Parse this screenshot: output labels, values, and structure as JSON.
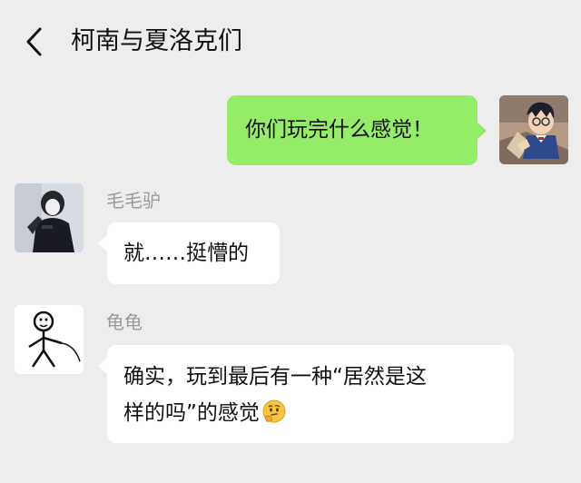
{
  "header": {
    "title": "柯南与夏洛克们"
  },
  "messages": [
    {
      "side": "right",
      "text": "你们玩完什么感觉！",
      "avatar_icon": "conan-avatar-icon"
    },
    {
      "side": "left",
      "sender": "毛毛驴",
      "text": "就……挺懵的",
      "avatar_icon": "dark-figure-avatar-icon"
    },
    {
      "side": "left",
      "sender": "龟龟",
      "text_line1": "确实，玩到最后有一种“居然是这",
      "text_line2": "样的吗”的感觉",
      "emoji": "thinking-face-emoji",
      "avatar_icon": "stick-figure-avatar-icon"
    }
  ],
  "colors": {
    "background": "#ededed",
    "my_bubble": "#95ec69",
    "other_bubble": "#ffffff",
    "sender_name": "#9a9a9a"
  }
}
